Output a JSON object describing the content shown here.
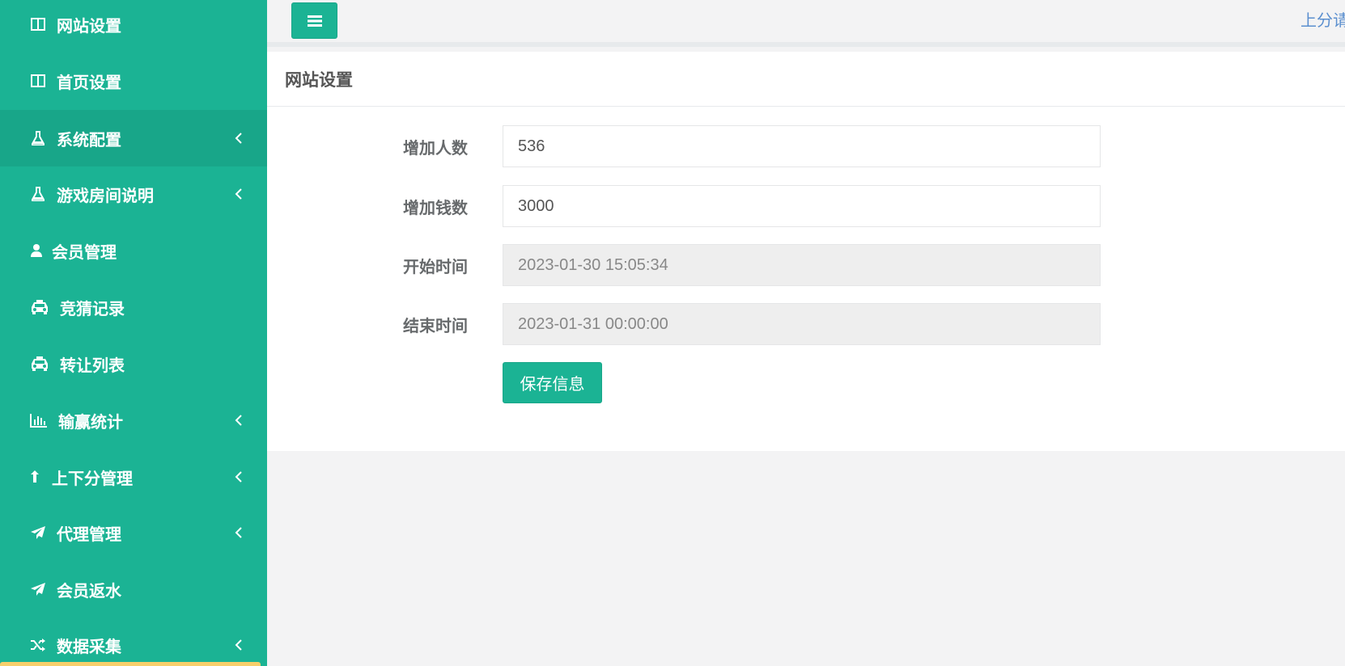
{
  "sidebar": {
    "items": [
      {
        "label": "网站设置",
        "icon": "columns-icon",
        "has_submenu": false,
        "active": false
      },
      {
        "label": "首页设置",
        "icon": "columns-icon",
        "has_submenu": false,
        "active": false
      },
      {
        "label": "系统配置",
        "icon": "flask-icon",
        "has_submenu": true,
        "active": true
      },
      {
        "label": "游戏房间说明",
        "icon": "flask-icon",
        "has_submenu": true,
        "active": false
      },
      {
        "label": "会员管理",
        "icon": "user-icon",
        "has_submenu": false,
        "active": false
      },
      {
        "label": "竞猜记录",
        "icon": "cab-icon",
        "has_submenu": false,
        "active": false
      },
      {
        "label": "转让列表",
        "icon": "cab-icon",
        "has_submenu": false,
        "active": false
      },
      {
        "label": "输赢统计",
        "icon": "bar-chart-icon",
        "has_submenu": true,
        "active": false
      },
      {
        "label": "上下分管理",
        "icon": "level-up-icon",
        "has_submenu": true,
        "active": false
      },
      {
        "label": "代理管理",
        "icon": "paper-plane-icon",
        "has_submenu": true,
        "active": false
      },
      {
        "label": "会员返水",
        "icon": "paper-plane-icon",
        "has_submenu": false,
        "active": false
      },
      {
        "label": "数据采集",
        "icon": "random-icon",
        "has_submenu": true,
        "active": false
      }
    ]
  },
  "topbar": {
    "menu_button_icon": "bars-icon",
    "right_link": "上分请"
  },
  "panel": {
    "title": "网站设置",
    "fields": [
      {
        "label": "增加人数",
        "value": "536",
        "readonly": false
      },
      {
        "label": "增加钱数",
        "value": "3000",
        "readonly": false
      },
      {
        "label": "开始时间",
        "value": "2023-01-30 15:05:34",
        "readonly": true
      },
      {
        "label": "结束时间",
        "value": "2023-01-31 00:00:00",
        "readonly": true
      }
    ],
    "save_label": "保存信息"
  },
  "colors": {
    "sidebar_bg": "#1bb394",
    "sidebar_active_bg": "#18a689",
    "primary": "#1bb394",
    "link": "#5b8fcf"
  }
}
